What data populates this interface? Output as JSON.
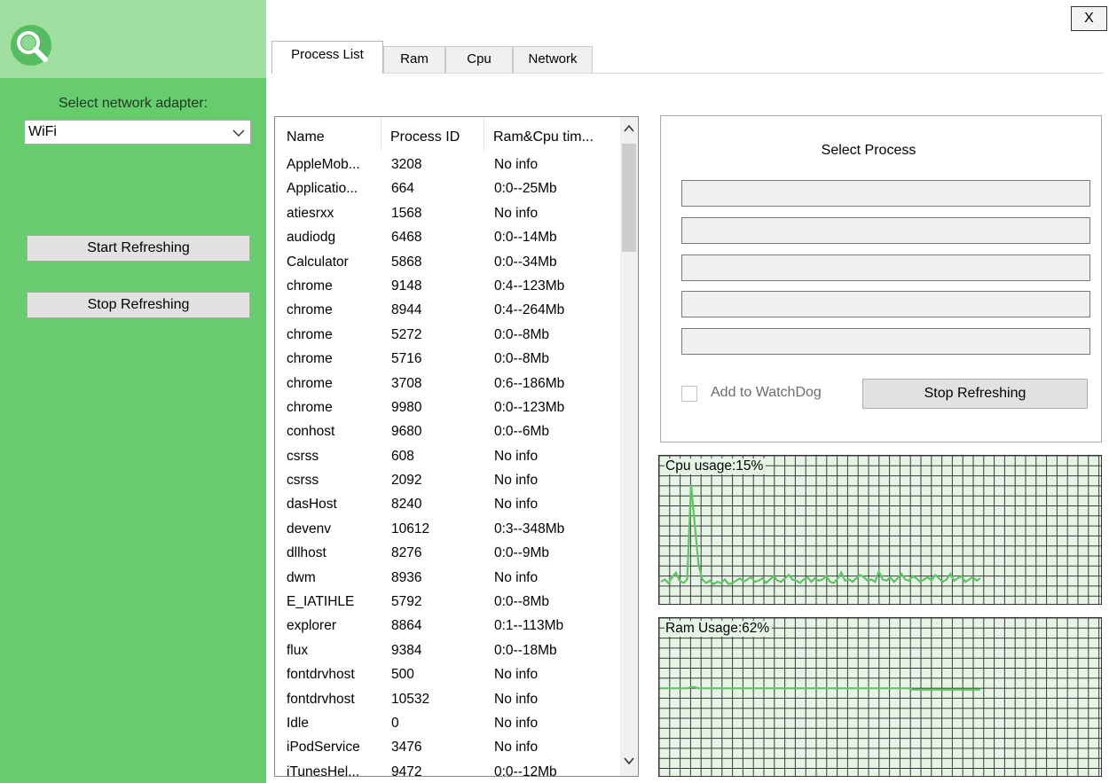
{
  "app": {
    "close_label": "X"
  },
  "sidebar": {
    "adapter_label": "Select network adapter:",
    "adapter_value": "WiFi",
    "start_label": "Start Refreshing",
    "stop_label": "Stop Refreshing"
  },
  "tabs": [
    {
      "label": "Process List",
      "active": true
    },
    {
      "label": "Ram",
      "active": false
    },
    {
      "label": "Cpu",
      "active": false
    },
    {
      "label": "Network",
      "active": false
    }
  ],
  "process_list": {
    "columns": [
      "Name",
      "Process ID",
      "Ram&Cpu tim..."
    ],
    "rows": [
      [
        "AppleMob...",
        "3208",
        "No info"
      ],
      [
        "Applicatio...",
        "664",
        "0:0--25Mb"
      ],
      [
        "atiesrxx",
        "1568",
        "No info"
      ],
      [
        "audiodg",
        "6468",
        "0:0--14Mb"
      ],
      [
        "Calculator",
        "5868",
        "0:0--34Mb"
      ],
      [
        "chrome",
        "9148",
        "0:4--123Mb"
      ],
      [
        "chrome",
        "8944",
        "0:4--264Mb"
      ],
      [
        "chrome",
        "5272",
        "0:0--8Mb"
      ],
      [
        "chrome",
        "5716",
        "0:0--8Mb"
      ],
      [
        "chrome",
        "3708",
        "0:6--186Mb"
      ],
      [
        "chrome",
        "9980",
        "0:0--123Mb"
      ],
      [
        "conhost",
        "9680",
        "0:0--6Mb"
      ],
      [
        "csrss",
        "608",
        "No info"
      ],
      [
        "csrss",
        "2092",
        "No info"
      ],
      [
        "dasHost",
        "8240",
        "No info"
      ],
      [
        "devenv",
        "10612",
        "0:3--348Mb"
      ],
      [
        "dllhost",
        "8276",
        "0:0--9Mb"
      ],
      [
        "dwm",
        "8936",
        "No info"
      ],
      [
        "E_IATIHLE",
        "5792",
        "0:0--8Mb"
      ],
      [
        "explorer",
        "8864",
        "0:1--113Mb"
      ],
      [
        "flux",
        "9384",
        "0:0--18Mb"
      ],
      [
        "fontdrvhost",
        "500",
        "No info"
      ],
      [
        "fontdrvhost",
        "10532",
        "No info"
      ],
      [
        "Idle",
        "0",
        "No info"
      ],
      [
        "iPodService",
        "3476",
        "No info"
      ],
      [
        "iTunesHel...",
        "9472",
        "0:0--12Mb"
      ]
    ]
  },
  "select_panel": {
    "title": "Select Process",
    "fields": [
      "",
      "",
      "",
      "",
      ""
    ],
    "watchdog_label": "Add to WatchDog",
    "watchdog_checked": false,
    "stop_label": "Stop Refreshing"
  },
  "graphs": {
    "cpu": {
      "label": "Cpu usage:15%",
      "color": "#5ec466",
      "values": [
        10,
        12,
        9,
        14,
        18,
        11,
        9,
        12,
        95,
        60,
        25,
        12,
        9,
        11,
        8,
        10,
        9,
        12,
        8,
        9,
        11,
        13,
        10,
        12,
        14,
        10,
        11,
        13,
        9,
        12,
        15,
        11,
        10,
        13,
        16,
        12,
        11,
        9,
        12,
        14,
        10,
        13,
        11,
        12,
        15,
        10,
        9,
        13,
        18,
        11,
        12,
        10,
        13,
        16,
        14,
        11,
        12,
        10,
        19,
        12,
        11,
        14,
        10,
        13,
        17,
        12,
        11,
        15,
        13,
        10,
        12,
        14,
        11,
        16,
        13,
        10,
        12,
        17,
        11,
        13,
        15,
        10,
        12,
        14,
        11,
        13
      ]
    },
    "ram": {
      "label": "Ram Usage:62%",
      "color": "#5ec466",
      "values": [
        62,
        62,
        62,
        62,
        62,
        62,
        62,
        62,
        63,
        63,
        62,
        62,
        62,
        62,
        62,
        62,
        62,
        62,
        62,
        62,
        62,
        62,
        62,
        62,
        62,
        62,
        62,
        62,
        62,
        62,
        62,
        62,
        62,
        62,
        62,
        62,
        62,
        62,
        62,
        62,
        62,
        62,
        62,
        62,
        62,
        62,
        62,
        62,
        62,
        62,
        62,
        62,
        62,
        62,
        62,
        62,
        62,
        62,
        62,
        62,
        62,
        62,
        62,
        62,
        62,
        62,
        62,
        61,
        61,
        61,
        61,
        61,
        61,
        61,
        61,
        61,
        61,
        61,
        61,
        61,
        61,
        61,
        61,
        61,
        61,
        61
      ]
    }
  }
}
